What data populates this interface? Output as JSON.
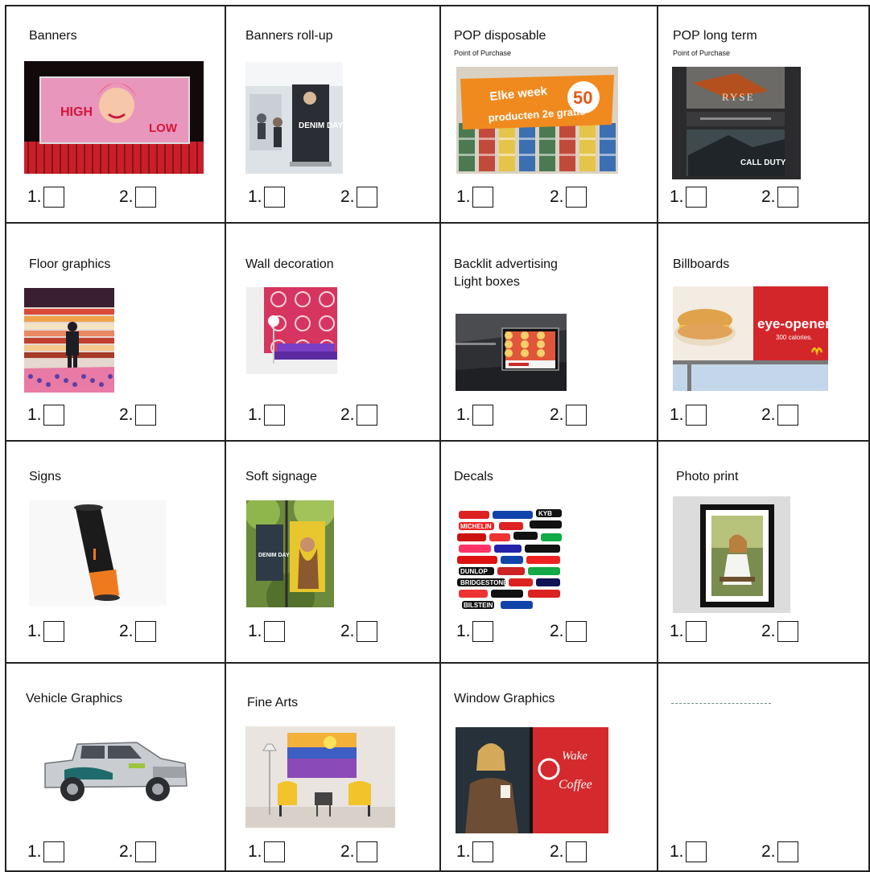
{
  "option_1_label": "1.",
  "option_2_label": "2.",
  "cells": [
    {
      "title": "Banners",
      "line2": "",
      "subtitle": ""
    },
    {
      "title": "Banners  roll-up",
      "line2": "",
      "subtitle": ""
    },
    {
      "title": "POP  disposable",
      "line2": "",
      "subtitle": "Point  of Purchase"
    },
    {
      "title": "POP  long  term",
      "line2": "",
      "subtitle": "Point  of Purchase"
    },
    {
      "title": "Floor graphics",
      "line2": "",
      "subtitle": ""
    },
    {
      "title": "Wall decoration",
      "line2": "",
      "subtitle": ""
    },
    {
      "title": "Backlit  advertising",
      "line2": "Light  boxes",
      "subtitle": ""
    },
    {
      "title": "Billboards",
      "line2": "",
      "subtitle": ""
    },
    {
      "title": "Signs",
      "line2": "",
      "subtitle": ""
    },
    {
      "title": "Soft signage",
      "line2": "",
      "subtitle": ""
    },
    {
      "title": "Decals",
      "line2": "",
      "subtitle": ""
    },
    {
      "title": "Photo print",
      "line2": "",
      "subtitle": ""
    },
    {
      "title": "Vehicle  Graphics",
      "line2": "",
      "subtitle": ""
    },
    {
      "title": "Fine Arts",
      "line2": "",
      "subtitle": ""
    },
    {
      "title": "Window  Graphics",
      "line2": "",
      "subtitle": ""
    },
    {
      "title": "",
      "line2": "",
      "subtitle": ""
    }
  ],
  "image_text": {
    "banner_high": "HIGH",
    "banner_low": "LOW",
    "rollup_text": "DENIM DAYS",
    "pop_week": "Elke week",
    "pop_50": "50",
    "pop_products": "producten 2e gratis",
    "poplong_rise": "RYSE",
    "poplong_cod": "CALL DUTY",
    "billboard_slogan": "eye-opener.",
    "billboard_cal": "300 calories.",
    "soft_text": "DENIM DAYS",
    "window_wake": "Wake",
    "window_coffee": "Coffee",
    "decal_1": "MICHELIN",
    "decal_2": "BRIDGESTONE",
    "decal_3": "DUNLOP",
    "decal_4": "BILSTEIN",
    "decal_5": "KYB"
  }
}
